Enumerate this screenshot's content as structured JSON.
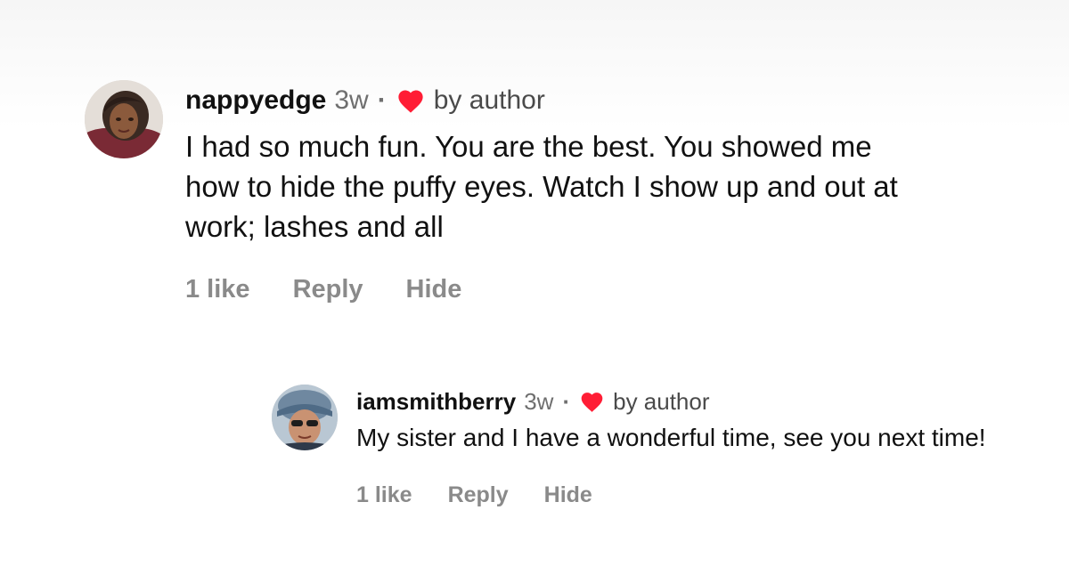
{
  "comments": [
    {
      "username": "nappyedge",
      "time": "3w",
      "separator": "·",
      "liked_by_author_label": "by author",
      "text": "I had so much fun. You are the best. You showed me how to hide the puffy eyes. Watch I show up and out at work; lashes and all",
      "likes_label": "1 like",
      "reply_label": "Reply",
      "hide_label": "Hide"
    },
    {
      "username": "iamsmithberry",
      "time": "3w",
      "separator": "·",
      "liked_by_author_label": "by author",
      "text": "My sister and I have a wonderful time, see you next time!",
      "likes_label": "1 like",
      "reply_label": "Reply",
      "hide_label": "Hide"
    }
  ],
  "icons": {
    "heart": "heart-icon"
  },
  "colors": {
    "heart": "#ff1d35",
    "muted_text": "#8a8a8a",
    "timestamp": "#6f6f6f"
  }
}
